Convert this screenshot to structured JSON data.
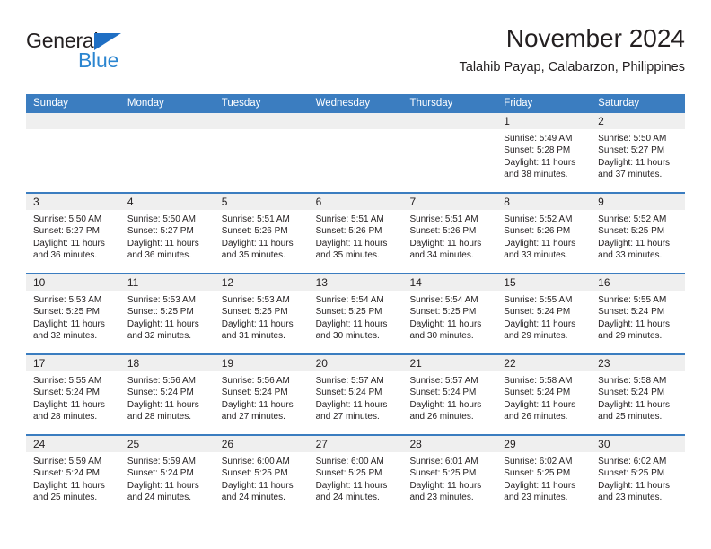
{
  "brand": {
    "name_part1": "General",
    "name_part2": "Blue",
    "triangle_color": "#1f6fc4",
    "blue_color": "#2b85d0"
  },
  "header": {
    "title": "November 2024",
    "subtitle": "Talahib Payap, Calabarzon, Philippines"
  },
  "theme": {
    "header_blue": "#3b7dc0",
    "day_band_gray": "#efefef",
    "text": "#231f20"
  },
  "calendar": {
    "weekday_headers": [
      "Sunday",
      "Monday",
      "Tuesday",
      "Wednesday",
      "Thursday",
      "Friday",
      "Saturday"
    ],
    "weeks": [
      [
        {
          "day": "",
          "lines": []
        },
        {
          "day": "",
          "lines": []
        },
        {
          "day": "",
          "lines": []
        },
        {
          "day": "",
          "lines": []
        },
        {
          "day": "",
          "lines": []
        },
        {
          "day": "1",
          "lines": [
            "Sunrise: 5:49 AM",
            "Sunset: 5:28 PM",
            "Daylight: 11 hours and 38 minutes."
          ]
        },
        {
          "day": "2",
          "lines": [
            "Sunrise: 5:50 AM",
            "Sunset: 5:27 PM",
            "Daylight: 11 hours and 37 minutes."
          ]
        }
      ],
      [
        {
          "day": "3",
          "lines": [
            "Sunrise: 5:50 AM",
            "Sunset: 5:27 PM",
            "Daylight: 11 hours and 36 minutes."
          ]
        },
        {
          "day": "4",
          "lines": [
            "Sunrise: 5:50 AM",
            "Sunset: 5:27 PM",
            "Daylight: 11 hours and 36 minutes."
          ]
        },
        {
          "day": "5",
          "lines": [
            "Sunrise: 5:51 AM",
            "Sunset: 5:26 PM",
            "Daylight: 11 hours and 35 minutes."
          ]
        },
        {
          "day": "6",
          "lines": [
            "Sunrise: 5:51 AM",
            "Sunset: 5:26 PM",
            "Daylight: 11 hours and 35 minutes."
          ]
        },
        {
          "day": "7",
          "lines": [
            "Sunrise: 5:51 AM",
            "Sunset: 5:26 PM",
            "Daylight: 11 hours and 34 minutes."
          ]
        },
        {
          "day": "8",
          "lines": [
            "Sunrise: 5:52 AM",
            "Sunset: 5:26 PM",
            "Daylight: 11 hours and 33 minutes."
          ]
        },
        {
          "day": "9",
          "lines": [
            "Sunrise: 5:52 AM",
            "Sunset: 5:25 PM",
            "Daylight: 11 hours and 33 minutes."
          ]
        }
      ],
      [
        {
          "day": "10",
          "lines": [
            "Sunrise: 5:53 AM",
            "Sunset: 5:25 PM",
            "Daylight: 11 hours and 32 minutes."
          ]
        },
        {
          "day": "11",
          "lines": [
            "Sunrise: 5:53 AM",
            "Sunset: 5:25 PM",
            "Daylight: 11 hours and 32 minutes."
          ]
        },
        {
          "day": "12",
          "lines": [
            "Sunrise: 5:53 AM",
            "Sunset: 5:25 PM",
            "Daylight: 11 hours and 31 minutes."
          ]
        },
        {
          "day": "13",
          "lines": [
            "Sunrise: 5:54 AM",
            "Sunset: 5:25 PM",
            "Daylight: 11 hours and 30 minutes."
          ]
        },
        {
          "day": "14",
          "lines": [
            "Sunrise: 5:54 AM",
            "Sunset: 5:25 PM",
            "Daylight: 11 hours and 30 minutes."
          ]
        },
        {
          "day": "15",
          "lines": [
            "Sunrise: 5:55 AM",
            "Sunset: 5:24 PM",
            "Daylight: 11 hours and 29 minutes."
          ]
        },
        {
          "day": "16",
          "lines": [
            "Sunrise: 5:55 AM",
            "Sunset: 5:24 PM",
            "Daylight: 11 hours and 29 minutes."
          ]
        }
      ],
      [
        {
          "day": "17",
          "lines": [
            "Sunrise: 5:55 AM",
            "Sunset: 5:24 PM",
            "Daylight: 11 hours and 28 minutes."
          ]
        },
        {
          "day": "18",
          "lines": [
            "Sunrise: 5:56 AM",
            "Sunset: 5:24 PM",
            "Daylight: 11 hours and 28 minutes."
          ]
        },
        {
          "day": "19",
          "lines": [
            "Sunrise: 5:56 AM",
            "Sunset: 5:24 PM",
            "Daylight: 11 hours and 27 minutes."
          ]
        },
        {
          "day": "20",
          "lines": [
            "Sunrise: 5:57 AM",
            "Sunset: 5:24 PM",
            "Daylight: 11 hours and 27 minutes."
          ]
        },
        {
          "day": "21",
          "lines": [
            "Sunrise: 5:57 AM",
            "Sunset: 5:24 PM",
            "Daylight: 11 hours and 26 minutes."
          ]
        },
        {
          "day": "22",
          "lines": [
            "Sunrise: 5:58 AM",
            "Sunset: 5:24 PM",
            "Daylight: 11 hours and 26 minutes."
          ]
        },
        {
          "day": "23",
          "lines": [
            "Sunrise: 5:58 AM",
            "Sunset: 5:24 PM",
            "Daylight: 11 hours and 25 minutes."
          ]
        }
      ],
      [
        {
          "day": "24",
          "lines": [
            "Sunrise: 5:59 AM",
            "Sunset: 5:24 PM",
            "Daylight: 11 hours and 25 minutes."
          ]
        },
        {
          "day": "25",
          "lines": [
            "Sunrise: 5:59 AM",
            "Sunset: 5:24 PM",
            "Daylight: 11 hours and 24 minutes."
          ]
        },
        {
          "day": "26",
          "lines": [
            "Sunrise: 6:00 AM",
            "Sunset: 5:25 PM",
            "Daylight: 11 hours and 24 minutes."
          ]
        },
        {
          "day": "27",
          "lines": [
            "Sunrise: 6:00 AM",
            "Sunset: 5:25 PM",
            "Daylight: 11 hours and 24 minutes."
          ]
        },
        {
          "day": "28",
          "lines": [
            "Sunrise: 6:01 AM",
            "Sunset: 5:25 PM",
            "Daylight: 11 hours and 23 minutes."
          ]
        },
        {
          "day": "29",
          "lines": [
            "Sunrise: 6:02 AM",
            "Sunset: 5:25 PM",
            "Daylight: 11 hours and 23 minutes."
          ]
        },
        {
          "day": "30",
          "lines": [
            "Sunrise: 6:02 AM",
            "Sunset: 5:25 PM",
            "Daylight: 11 hours and 23 minutes."
          ]
        }
      ]
    ]
  }
}
